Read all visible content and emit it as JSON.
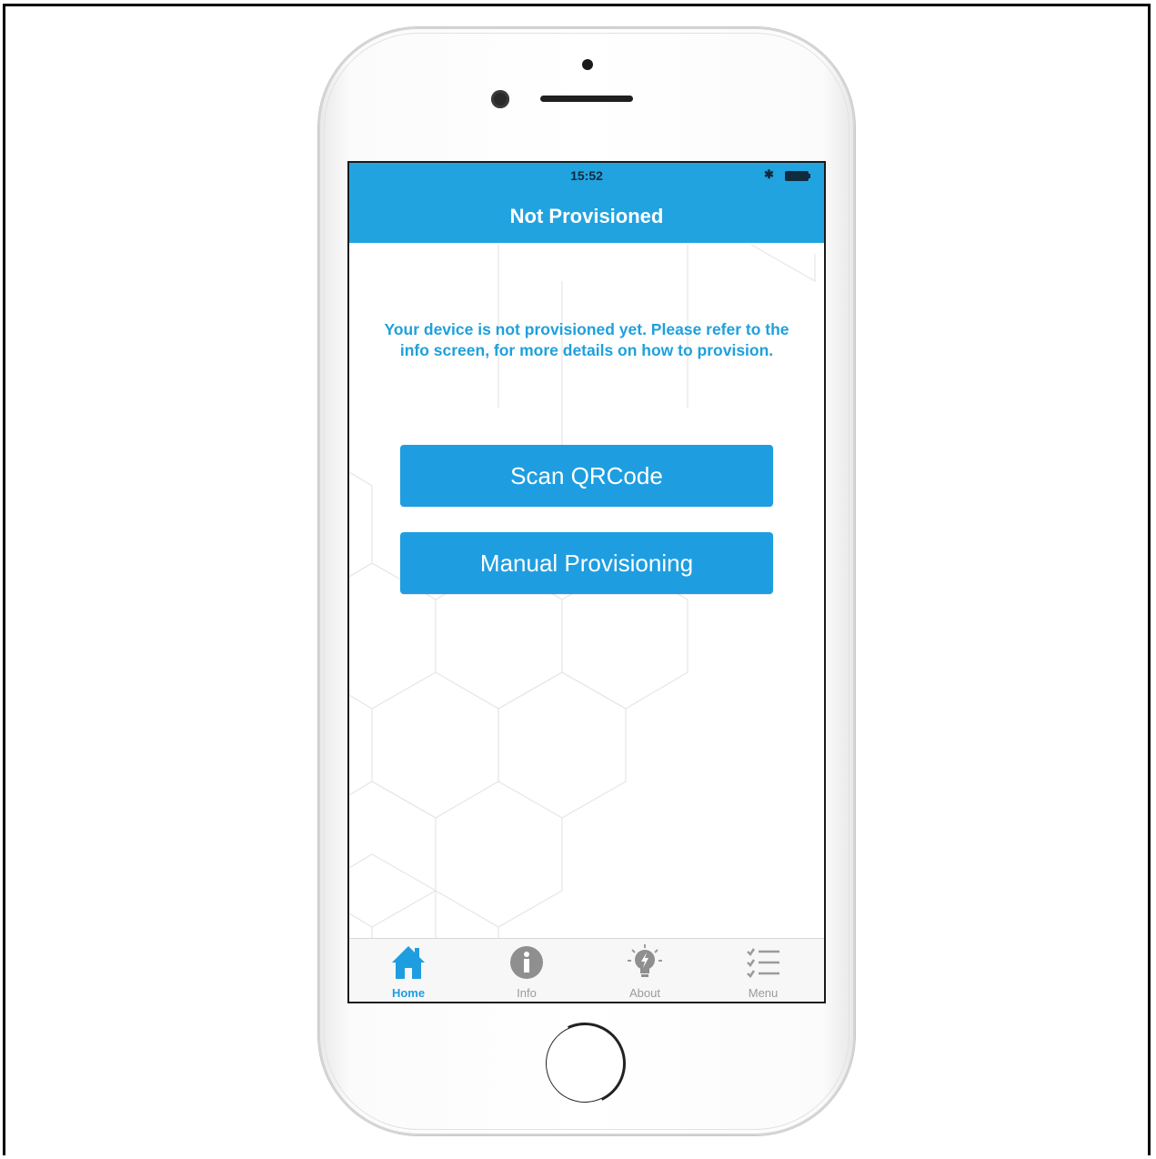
{
  "status_bar": {
    "time": "15:52",
    "bluetooth_icon": "bluetooth-icon",
    "battery_icon": "battery-icon"
  },
  "navbar": {
    "title": "Not Provisioned",
    "color": "#21a3e0"
  },
  "main": {
    "message": "Your device is not provisioned yet. Please refer to the info screen, for more details on how to provision.",
    "scan_button": "Scan QRCode",
    "manual_button": "Manual Provisioning"
  },
  "tabs": [
    {
      "label": "Home",
      "icon": "home-icon",
      "active": true
    },
    {
      "label": "Info",
      "icon": "info-icon",
      "active": false
    },
    {
      "label": "About",
      "icon": "lightbulb-icon",
      "active": false
    },
    {
      "label": "Menu",
      "icon": "checklist-icon",
      "active": false
    }
  ],
  "colors": {
    "accent": "#1e9ee0",
    "inactive": "#9b9b9b"
  }
}
